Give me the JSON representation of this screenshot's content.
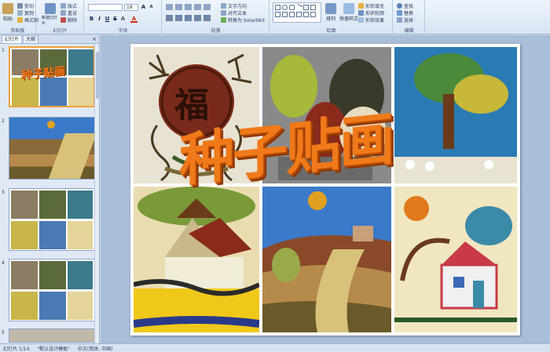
{
  "ribbon": {
    "clipboard": {
      "title": "剪贴板",
      "paste": "粘贴",
      "cut": "剪切",
      "copy": "复制",
      "format_painter": "格式刷"
    },
    "slides": {
      "title": "幻灯片",
      "new_slide": "新建幻灯片",
      "layout": "版式",
      "reset": "重设",
      "delete": "删除"
    },
    "font": {
      "title": "字体",
      "font_name": "",
      "font_size": "18",
      "bold": "B",
      "italic": "I",
      "underline": "U",
      "strike": "S",
      "shadow": "A",
      "size_up": "A",
      "size_down": "A"
    },
    "paragraph": {
      "title": "段落",
      "text_direction": "文字方向",
      "align_text": "对齐文本",
      "smartart": "转换为 SmartArt"
    },
    "drawing": {
      "title": "绘图",
      "arrange": "排列",
      "quick_styles": "快速样式",
      "shape_fill": "形状填充",
      "shape_outline": "形状轮廓",
      "shape_effects": "形状效果"
    },
    "editing": {
      "title": "编辑",
      "find": "查找",
      "replace": "替换",
      "select": "选择"
    }
  },
  "panel": {
    "tab_outline": "幻灯片",
    "tab_slides": "大纲",
    "close": "×"
  },
  "thumbs": [
    {
      "num": "1"
    },
    {
      "num": "2"
    },
    {
      "num": "3"
    },
    {
      "num": "4"
    },
    {
      "num": "5"
    }
  ],
  "slide": {
    "title": "种子贴画",
    "fu_char": "福"
  },
  "status": {
    "slide_counter": "幻灯片 1/14",
    "theme": "\"默认设计模板\"",
    "language": "中文(简体, 中国)"
  },
  "colors": {
    "accent": "#f07a1a",
    "ribbon_bg": "#dbe6f4",
    "editor_bg": "#a9bfd9"
  }
}
